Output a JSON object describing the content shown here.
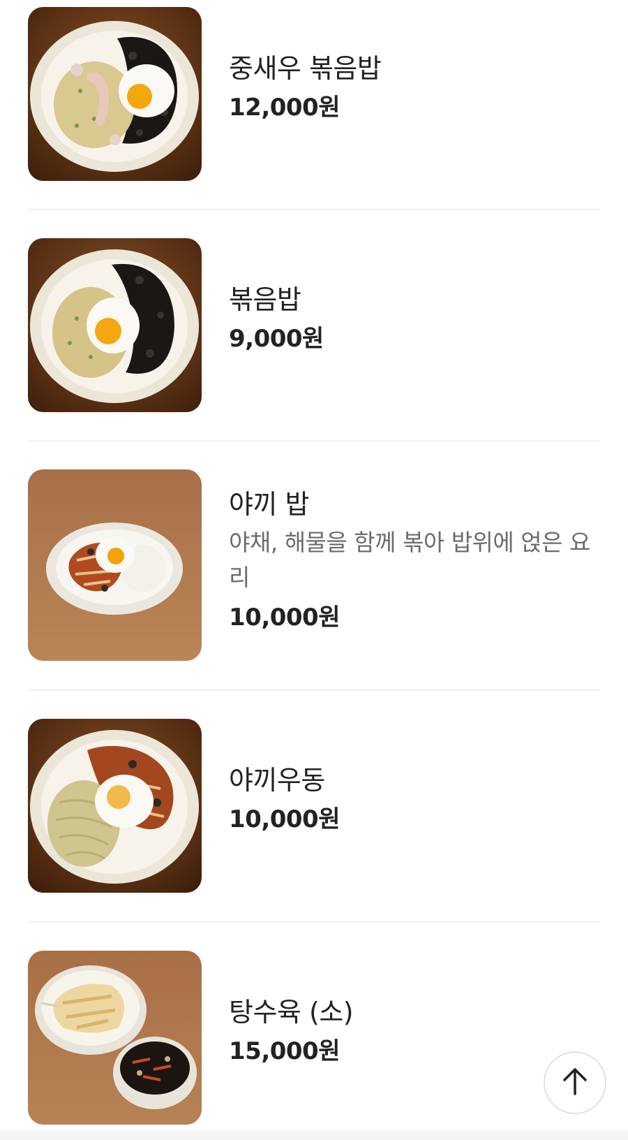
{
  "menu": {
    "items": [
      {
        "name": "중새우 볶음밥",
        "description": "",
        "price": "12,000원",
        "image": "shrimp-fried-rice-photo"
      },
      {
        "name": "볶음밥",
        "description": "",
        "price": "9,000원",
        "image": "fried-rice-photo"
      },
      {
        "name": "야끼 밥",
        "description": "야채, 해물을 함께 볶아 밥위에 얹은 요리",
        "price": "10,000원",
        "image": "yaki-rice-photo"
      },
      {
        "name": "야끼우동",
        "description": "",
        "price": "10,000원",
        "image": "yaki-udon-photo"
      },
      {
        "name": "탕수육 (소)",
        "description": "",
        "price": "15,000원",
        "image": "sweet-sour-pork-photo"
      }
    ]
  },
  "scroll_top_button": {
    "icon": "arrow-up-icon"
  },
  "colors": {
    "text_primary": "#222222",
    "text_secondary": "#6b6b6b",
    "divider": "#f0f0f0",
    "wood_dark": "#5b3316",
    "wood_light": "#b07a4e"
  }
}
